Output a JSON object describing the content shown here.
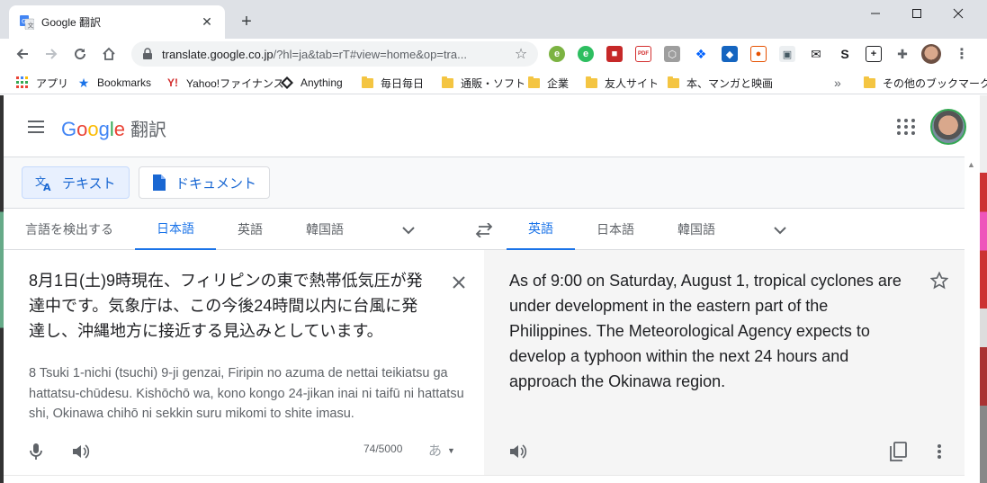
{
  "browser": {
    "tab": {
      "title": "Google 翻訳",
      "favicon": "google-translate-icon"
    },
    "omnibox": {
      "url_host": "translate.google.co.jp",
      "url_rest": "/?hl=ja&tab=rT#view=home&op=tra..."
    },
    "bookmarks": [
      {
        "label": "アプリ",
        "icon": "apps-grid-icon"
      },
      {
        "label": "Bookmarks",
        "icon": "star-icon"
      },
      {
        "label": "Yahoo!ファイナンス",
        "icon": "yahoo-icon"
      },
      {
        "label": "Anything",
        "icon": "diamond-icon"
      },
      {
        "label": "毎日毎日",
        "icon": "folder-icon"
      },
      {
        "label": "通販・ソフト",
        "icon": "folder-icon"
      },
      {
        "label": "企業",
        "icon": "folder-icon"
      },
      {
        "label": "友人サイト",
        "icon": "folder-icon"
      },
      {
        "label": "本、マンガと映画",
        "icon": "folder-icon"
      }
    ],
    "bookmarks_overflow": "»",
    "other_bookmarks": "その他のブックマーク"
  },
  "app": {
    "logo": {
      "g": "G",
      "o1": "o",
      "o2": "o",
      "g2": "g",
      "l": "l",
      "e": "e",
      "product": "翻訳"
    },
    "modes": {
      "text": "テキスト",
      "document": "ドキュメント"
    },
    "source_langs": {
      "detect": "言語を検出する",
      "ja": "日本語",
      "en": "英語",
      "ko": "韓国語"
    },
    "target_langs": {
      "en": "英語",
      "ja": "日本語",
      "ko": "韓国語"
    },
    "source_text": "8月1日(土)9時現在、フィリピンの東で熱帯低気圧が発達中です。気象庁は、この今後24時間以内に台風に発達し、沖縄地方に接近する見込みとしています。",
    "romanization": "8 Tsuki 1-nichi (tsuchi) 9-ji genzai, Firipin no azuma de nettai teikiatsu ga hattatsu-chūdesu. Kishōchō wa, kono kongo 24-jikan inai ni taifū ni hattatsu shi, Okinawa chihō ni sekkin suru mikomi to shite imasu.",
    "char_counter": "74/5000",
    "ime_mode": "あ",
    "translation": "As of 9:00 on Saturday, August 1, tropical cyclones are under development in the eastern part of the Philippines. The Meteorological Agency expects to develop a typhoon within the next 24 hours and approach the Okinawa region.",
    "colors": {
      "accent": "#1a73e8",
      "target_bg": "#f5f5f5"
    }
  }
}
